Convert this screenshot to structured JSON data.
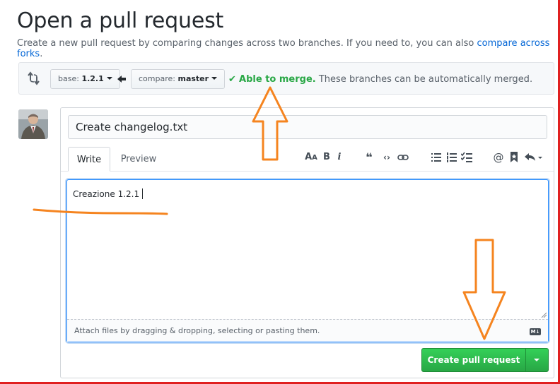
{
  "page": {
    "title": "Open a pull request",
    "subtitle_prefix": "Create a new pull request by comparing changes across two branches. If you need to, you can also",
    "subtitle_link": "compare across forks",
    "subtitle_suffix": "."
  },
  "range": {
    "base_label": "base:",
    "base_value": "1.2.1",
    "compare_label": "compare:",
    "compare_value": "master",
    "merge_ok": "Able to merge.",
    "merge_desc": "These branches can be automatically merged.",
    "status_color": "#28a745"
  },
  "form": {
    "title_value": "Create changelog.txt",
    "tabs": [
      {
        "label": "Write"
      },
      {
        "label": "Preview"
      }
    ],
    "toolbar_icons": [
      "header-icon",
      "bold-icon",
      "italic-icon",
      "quote-icon",
      "code-icon",
      "link-icon",
      "bulleted-list-icon",
      "numbered-list-icon",
      "task-list-icon",
      "mention-icon",
      "reference-icon",
      "reply-icon"
    ],
    "body_value": "Creazione 1.2.1",
    "attach_hint": "Attach files by dragging & dropping, selecting or pasting them.",
    "submit_label": "Create pull request",
    "accent_color": "#2188ff",
    "submit_color": "#28a745"
  },
  "annotations": {
    "color": "#f5841f"
  }
}
